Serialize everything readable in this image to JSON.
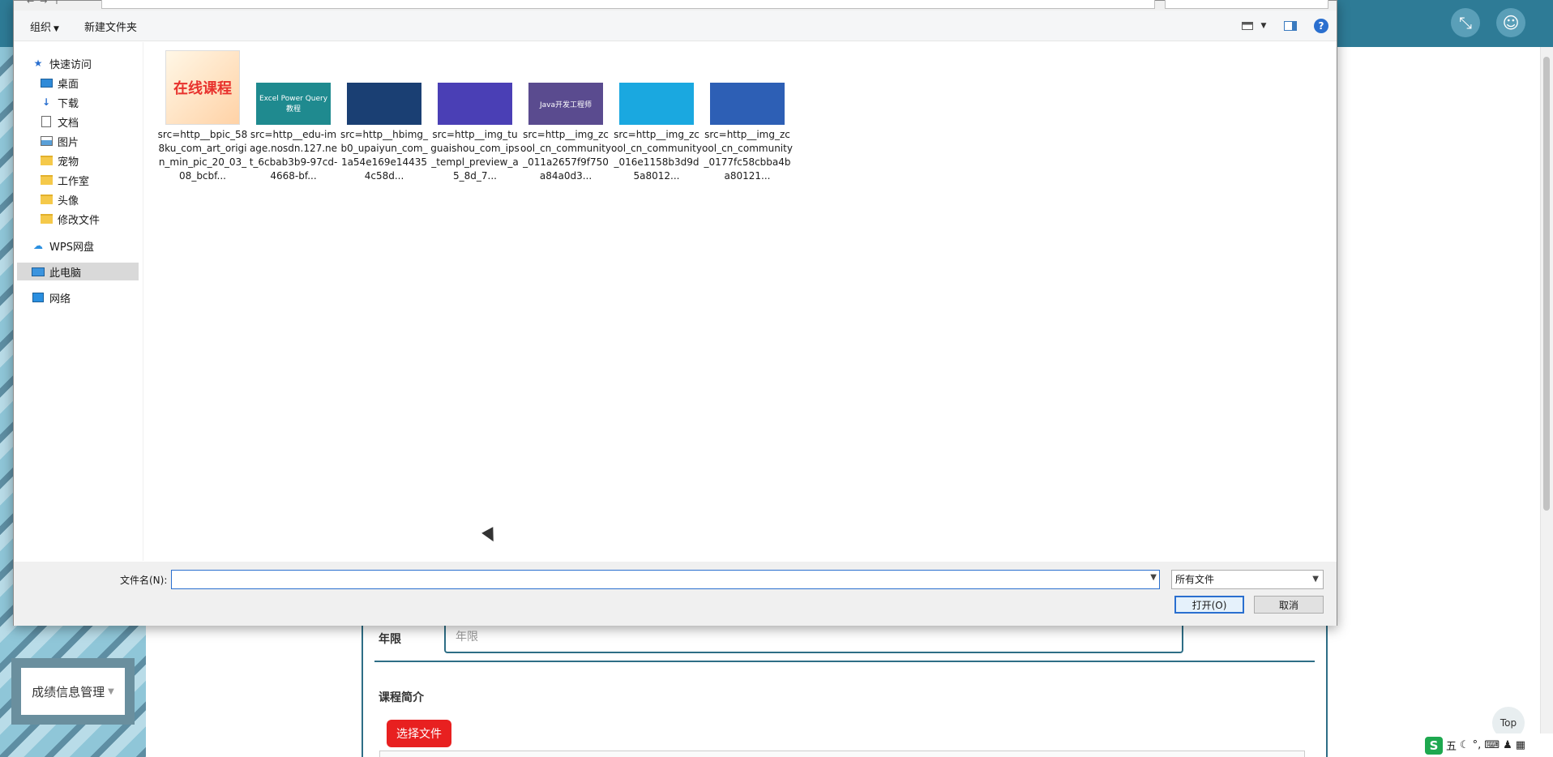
{
  "background": {
    "menu_label": "成绩信息管理",
    "field_year_label": "年限",
    "field_year_placeholder": "年限",
    "course_intro_label": "课程简介",
    "upload_button": "选择文件",
    "top_button": "Top",
    "ime": {
      "mode": "五"
    }
  },
  "dialog": {
    "toolbar": {
      "organize": "组织",
      "new_folder": "新建文件夹"
    },
    "nav": {
      "quick_access": "快速访问",
      "items": [
        {
          "label": "桌面",
          "icon": "desktop-icon",
          "pinned": true
        },
        {
          "label": "下载",
          "icon": "download-icon",
          "pinned": true
        },
        {
          "label": "文档",
          "icon": "document-icon",
          "pinned": true
        },
        {
          "label": "图片",
          "icon": "picture-icon",
          "pinned": true
        },
        {
          "label": "宠物",
          "icon": "folder-icon",
          "pinned": false
        },
        {
          "label": "工作室",
          "icon": "folder-icon",
          "pinned": false
        },
        {
          "label": "头像",
          "icon": "folder-icon",
          "pinned": false
        },
        {
          "label": "修改文件",
          "icon": "folder-icon",
          "pinned": false
        }
      ],
      "wps_cloud": "WPS网盘",
      "this_pc": "此电脑",
      "network": "网络"
    },
    "files": [
      {
        "name": "src=http__bpic_588ku_com_art_origin_min_pic_20_03_08_bcbf...",
        "thumb_text": "在线课程",
        "thumb_color": "#ffe0b8"
      },
      {
        "name": "src=http__edu-image.nosdn.127.net_6cbab3b9-97cd-4668-bf...",
        "thumb_text": "Excel Power Query 教程",
        "thumb_color": "#1f8a8f"
      },
      {
        "name": "src=http__hbimg_b0_upaiyun_com_1a54e169e144354c58d...",
        "thumb_text": "",
        "thumb_color": "#1a3f73"
      },
      {
        "name": "src=http__img_tuguaishou_com_ips_templ_preview_a5_8d_7...",
        "thumb_text": "",
        "thumb_color": "#4a3fb5"
      },
      {
        "name": "src=http__img_zcool_cn_community_011a2657f9f750a84a0d3...",
        "thumb_text": "Java开发工程师",
        "thumb_color": "#5a4b8f"
      },
      {
        "name": "src=http__img_zcool_cn_community_016e1158b3d9d5a8012...",
        "thumb_text": "",
        "thumb_color": "#1aa8e0"
      },
      {
        "name": "src=http__img_zcool_cn_community_0177fc58cbba4ba80121...",
        "thumb_text": "",
        "thumb_color": "#2d5fb5"
      }
    ],
    "filename_label": "文件名(N):",
    "filename_value": "",
    "filetype_value": "所有文件",
    "open_button": "打开(O)",
    "cancel_button": "取消"
  }
}
